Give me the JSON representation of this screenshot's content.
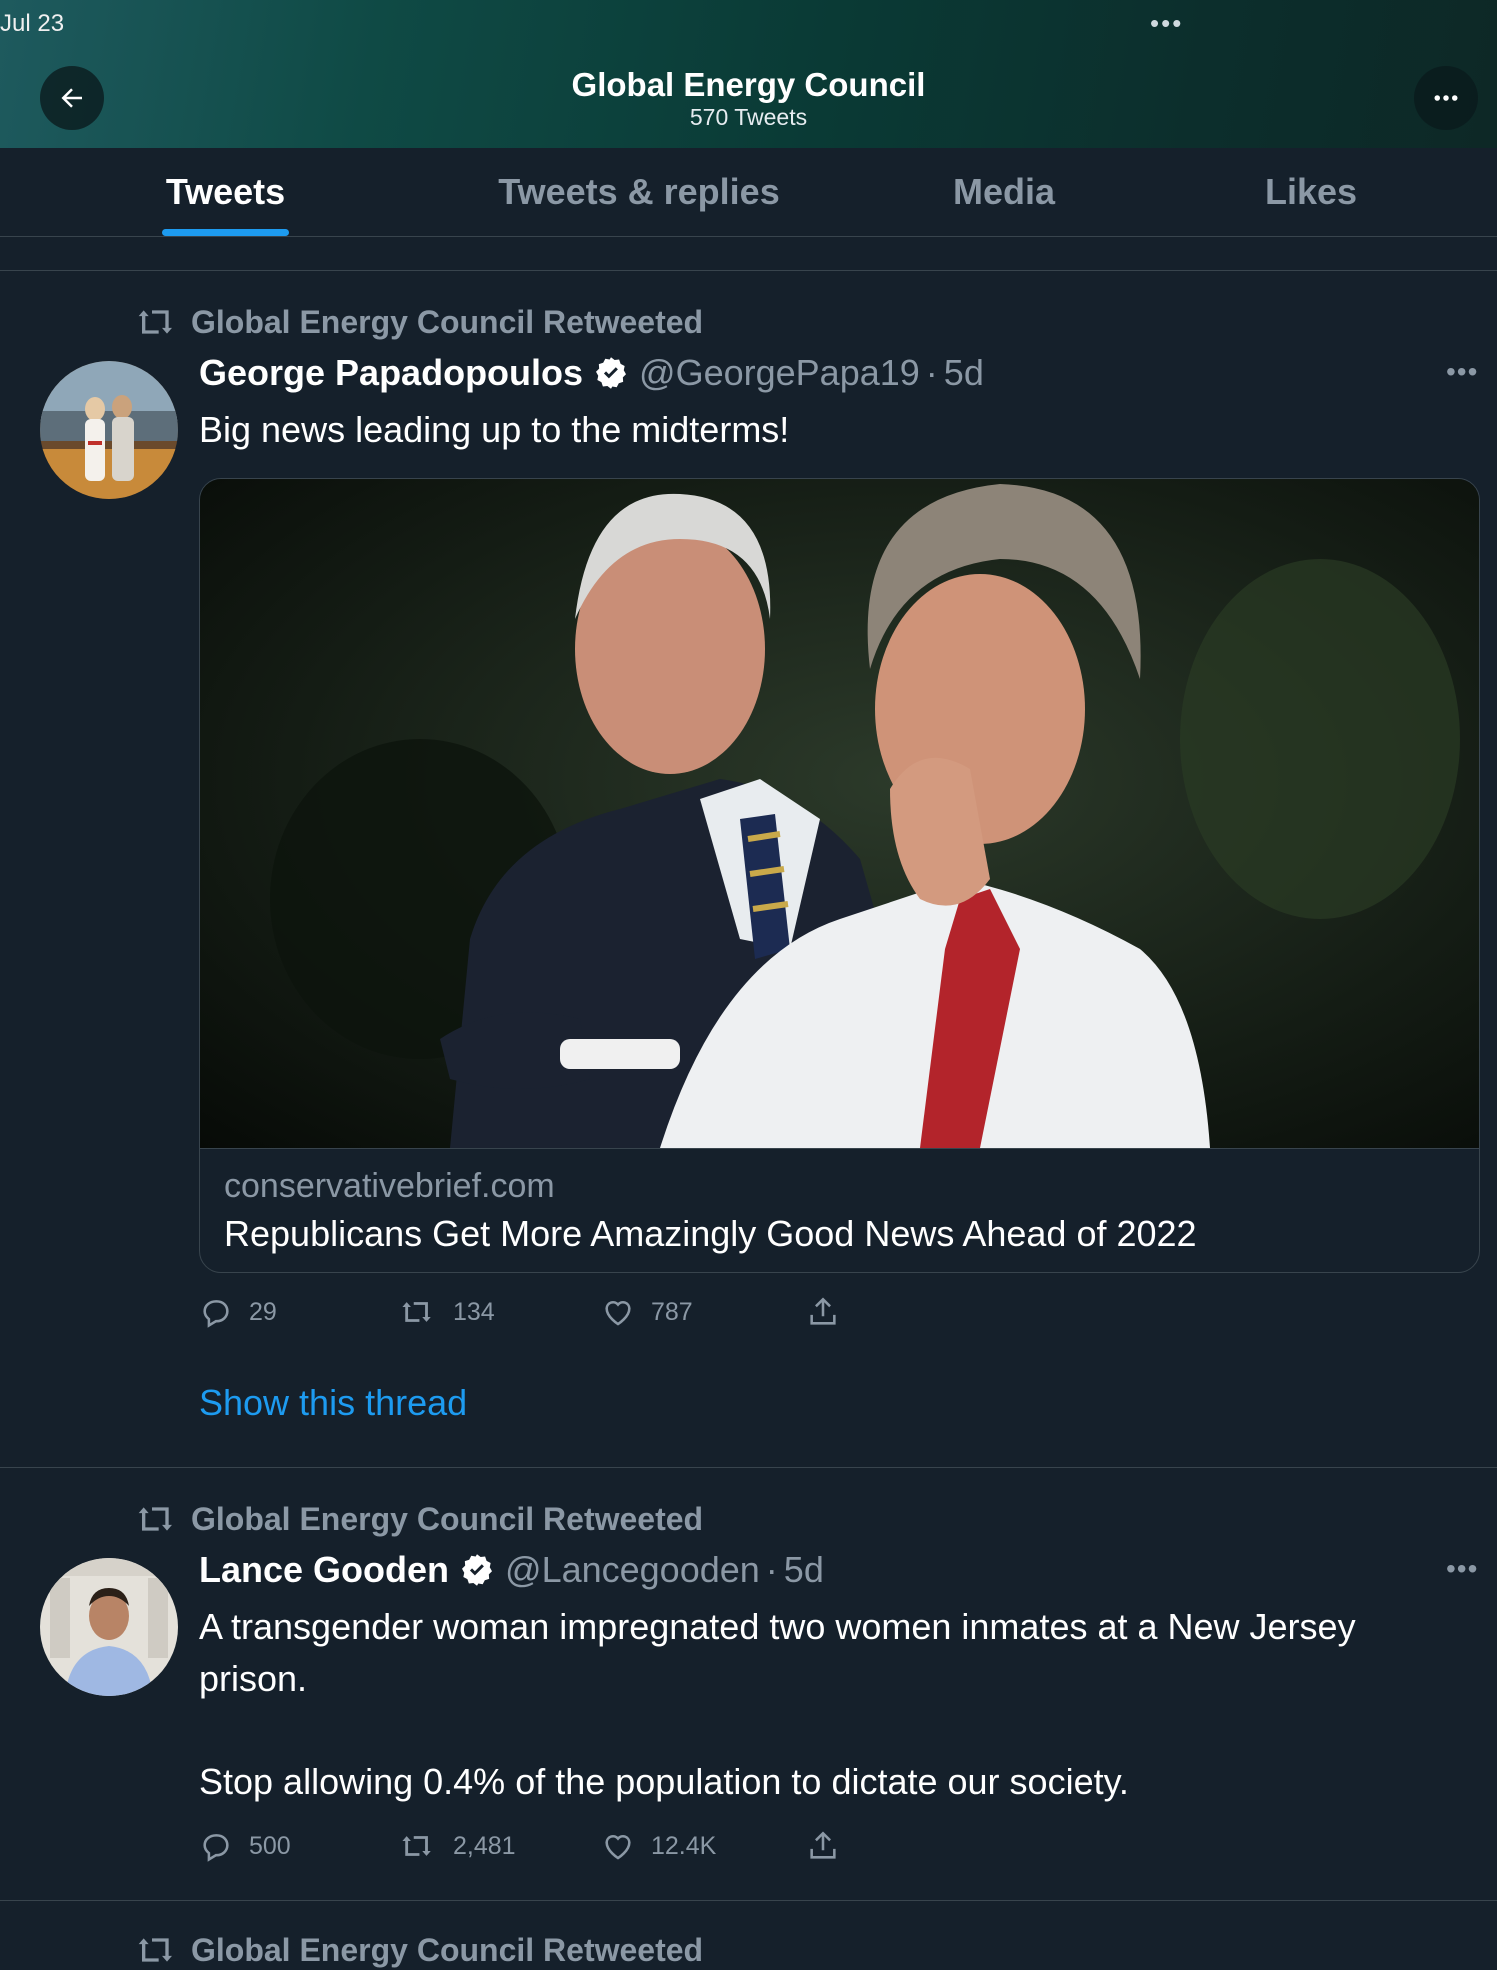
{
  "status": {
    "date": "Jul 23",
    "dots": "•••"
  },
  "header": {
    "title": "Global Energy Council",
    "subtitle": "570 Tweets"
  },
  "tabs": [
    {
      "label": "Tweets",
      "active": true
    },
    {
      "label": "Tweets & replies",
      "active": false
    },
    {
      "label": "Media",
      "active": false
    },
    {
      "label": "Likes",
      "active": false
    }
  ],
  "tweets": [
    {
      "retweet_label": "Global Energy Council Retweeted",
      "name": "George Papadopoulos",
      "handle": "@GeorgePapa19",
      "separator": "·",
      "time": "5d",
      "text": "Big news leading up to the midterms!",
      "card": {
        "domain": "conservativebrief.com",
        "title": "Republicans Get More Amazingly Good News Ahead of 2022"
      },
      "stats": {
        "replies": "29",
        "retweets": "134",
        "likes": "787"
      },
      "show_thread": "Show this thread"
    },
    {
      "retweet_label": "Global Energy Council Retweeted",
      "name": "Lance Gooden",
      "handle": "@Lancegooden",
      "separator": "·",
      "time": "5d",
      "text_line1": "A transgender woman impregnated two women inmates at a New Jersey",
      "text_line2": "prison.",
      "text_line3": "Stop allowing 0.4% of the population to dictate our society.",
      "stats": {
        "replies": "500",
        "retweets": "2,481",
        "likes": "12.4K"
      }
    },
    {
      "retweet_label": "Global Energy Council Retweeted"
    }
  ],
  "colors": {
    "background": "#15202b",
    "accent": "#1d9bf0",
    "muted": "#8b98a5",
    "border": "#38444d"
  }
}
